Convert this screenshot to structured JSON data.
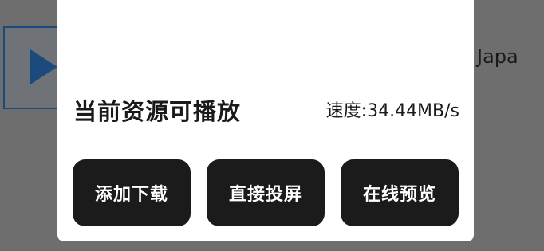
{
  "background": {
    "video_title_fragment": "Japa",
    "thumbnail_icon": "play-icon"
  },
  "dialog": {
    "status": "当前资源可播放",
    "speed": "速度:34.44MB/s",
    "buttons": [
      {
        "label": "添加下载"
      },
      {
        "label": "直接投屏"
      },
      {
        "label": "在线预览"
      }
    ]
  }
}
